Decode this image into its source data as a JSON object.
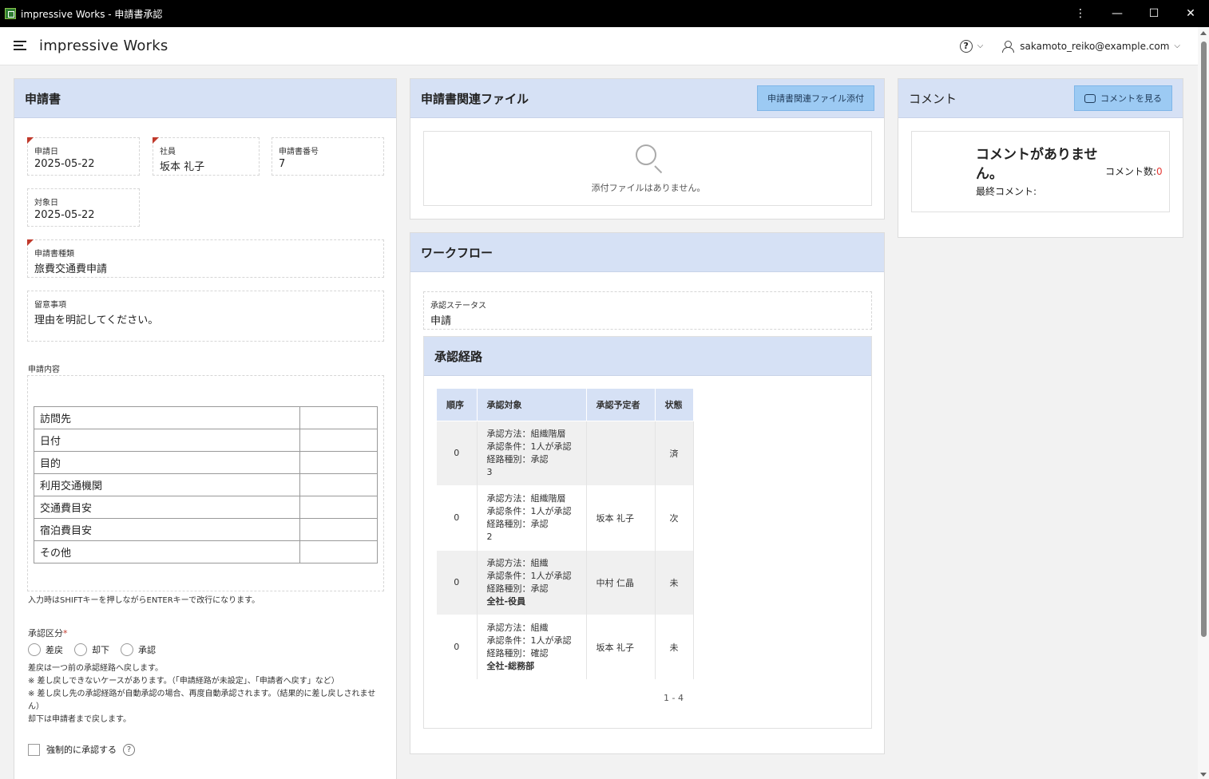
{
  "window": {
    "title": "impressive Works - 申請書承認"
  },
  "header": {
    "brand": "impressive Works",
    "user_email": "sakamoto_reiko@example.com"
  },
  "application": {
    "title": "申請書",
    "fields": {
      "date": {
        "label": "申請日",
        "value": "2025-05-22"
      },
      "employee": {
        "label": "社員",
        "value": "坂本 礼子"
      },
      "number": {
        "label": "申請書番号",
        "value": "7"
      },
      "target_date": {
        "label": "対象日",
        "value": "2025-05-22"
      },
      "type": {
        "label": "申請書種類",
        "value": "旅費交通費申請"
      },
      "notes": {
        "label": "留意事項",
        "value": "理由を明記してください。"
      }
    },
    "content_label": "申請内容",
    "content_rows": [
      "訪問先",
      "日付",
      "目的",
      "利用交通機関",
      "交通費目安",
      "宿泊費目安",
      "その他"
    ],
    "content_hint": "入力時はSHIFTキーを押しながらENTERキーで改行になります。",
    "approval_label": "承認区分",
    "approval_required": "*",
    "approval_options": [
      "差戻",
      "却下",
      "承認"
    ],
    "approval_notes": [
      "差戻は一つ前の承認経路へ戻します。",
      "※ 差し戻しできないケースがあります。（「申請経路が未設定」、「申請者へ戻す」など）",
      "※ 差し戻し先の承認経路が自動承認の場合、再度自動承認されます。（結果的に差し戻しされませ",
      "ん）",
      "却下は申請者まで戻します。"
    ],
    "force_approve_label": "強制的に承認する"
  },
  "files": {
    "title": "申請書関連ファイル",
    "attach_button": "申請書関連ファイル添付",
    "empty_text": "添付ファイルはありません。"
  },
  "workflow": {
    "title": "ワークフロー",
    "status_label": "承認ステータス",
    "status_value": "申請",
    "route_title": "承認経路",
    "columns": [
      "順序",
      "承認対象",
      "承認予定者",
      "状態"
    ],
    "rows": [
      {
        "order": "0",
        "lines": [
          "承認方法：組織階層",
          "承認条件：1人が承認",
          "経路種別：承認"
        ],
        "extra": "3",
        "approver": "",
        "state": "済"
      },
      {
        "order": "0",
        "lines": [
          "承認方法：組織階層",
          "承認条件：1人が承認",
          "経路種別：承認"
        ],
        "extra": "2",
        "approver": "坂本 礼子",
        "state": "次"
      },
      {
        "order": "0",
        "lines": [
          "承認方法：組織",
          "承認条件：1人が承認",
          "経路種別：承認"
        ],
        "extra": "全社-役員",
        "approver": "中村 仁晶",
        "state": "未"
      },
      {
        "order": "0",
        "lines": [
          "承認方法：組織",
          "承認条件：1人が承認",
          "経路種別：確認"
        ],
        "extra": "全社-総務部",
        "approver": "坂本 礼子",
        "state": "未"
      }
    ],
    "pagination": "1 - 4"
  },
  "comments": {
    "title": "コメント",
    "view_button": "コメントを見る",
    "empty_line1": "コメントがありませ",
    "empty_line2": "ん。",
    "last_comment_label": "最終コメント:",
    "count_label": "コメント数:",
    "count_value": "0"
  },
  "colors": {
    "header_band": "#d6e1f5",
    "button": "#9ccaf3",
    "required": "#c0392b",
    "count": "#e53935"
  }
}
